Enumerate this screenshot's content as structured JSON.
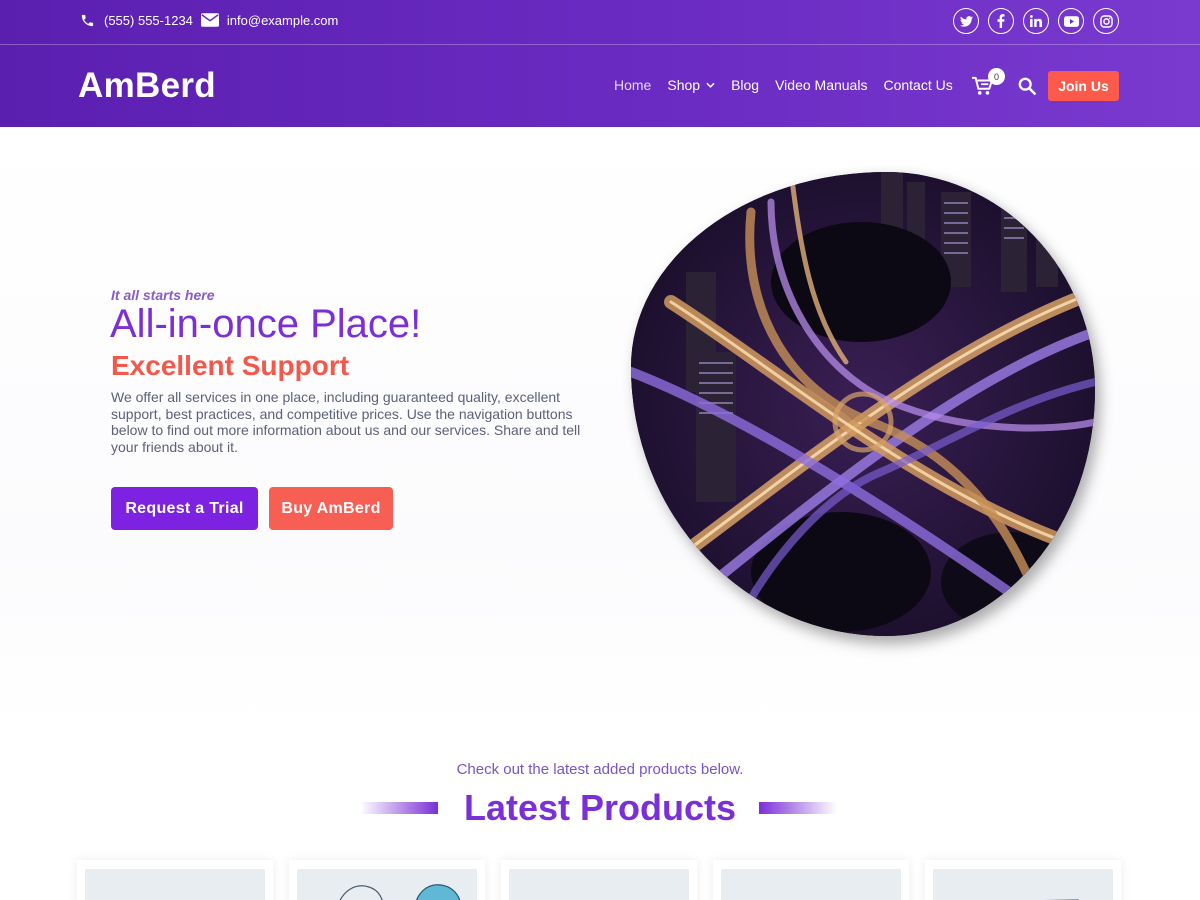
{
  "topbar": {
    "phone": "(555) 555-1234",
    "email": "info@example.com",
    "phone_icon": "phone-icon",
    "email_icon": "envelope-icon",
    "socials": [
      "twitter-icon",
      "facebook-icon",
      "linkedin-icon",
      "youtube-icon",
      "instagram-icon"
    ]
  },
  "header": {
    "logo": "AmBerd",
    "nav": [
      {
        "label": "Home",
        "active": true
      },
      {
        "label": "Shop",
        "dropdown": true
      },
      {
        "label": "Blog"
      },
      {
        "label": "Video Manuals"
      },
      {
        "label": "Contact Us"
      }
    ],
    "cart_count": "0",
    "join_label": "Join Us"
  },
  "hero": {
    "eyebrow": "It all starts here",
    "title": "All-in-once Place!",
    "subtitle": "Excellent Support",
    "description": "We offer all services in one place, including guaranteed quality, excellent support, best practices, and competitive prices. Use the navigation buttons below to find out more information about us and our services. Share and tell your friends about it.",
    "primary_button": "Request a Trial",
    "secondary_button": "Buy AmBerd"
  },
  "products": {
    "subtitle": "Check out the latest added products below.",
    "title": "Latest Products",
    "cards": 5
  },
  "colors": {
    "header_start": "#5b1fb0",
    "header_end": "#7a3ad0",
    "brand_purple": "#7b2fd6",
    "accent_coral": "#fd5a4c"
  }
}
